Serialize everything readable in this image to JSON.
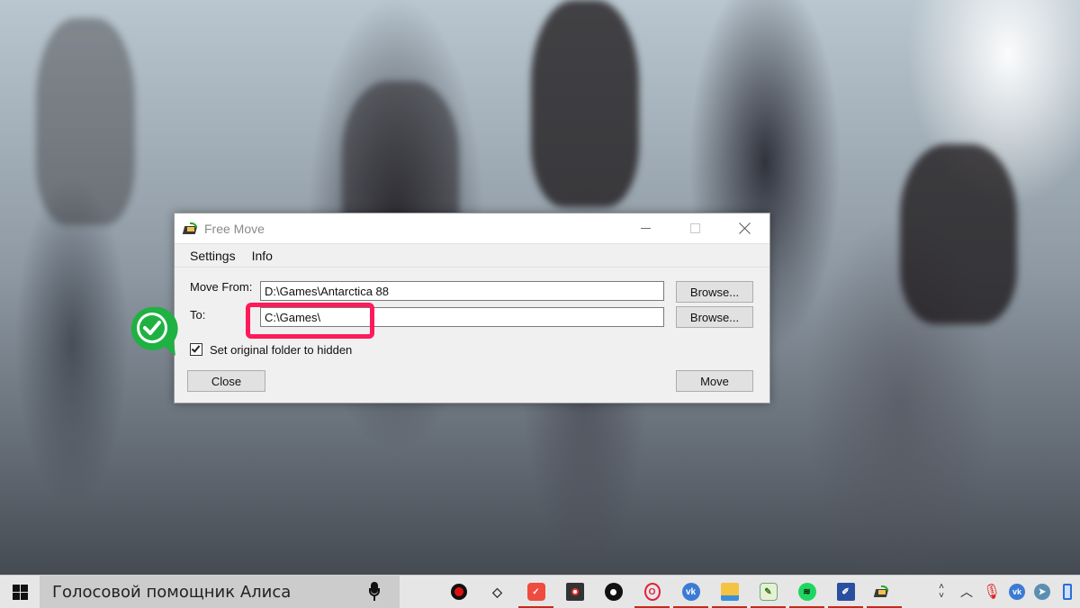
{
  "window": {
    "title": "Free Move",
    "controls": {
      "minimize": "minimize",
      "maximize": "maximize",
      "close": "close"
    },
    "menu": [
      {
        "label": "Settings"
      },
      {
        "label": "Info"
      }
    ],
    "form": {
      "move_from_label": "Move From:",
      "move_from_value": "D:\\Games\\Antarctica 88",
      "to_label": "To:",
      "to_value": "C:\\Games\\",
      "browse_label": "Browse...",
      "hidden_checkbox_label": "Set original folder to hidden",
      "hidden_checkbox_checked": true,
      "close_label": "Close",
      "move_label": "Move"
    }
  },
  "annotations": {
    "highlight_color": "#ff1a5a",
    "badge_color": "#1fb141"
  },
  "taskbar": {
    "search_text": "Голосовой помощник Алиса",
    "apps": [
      {
        "name": "recorder",
        "running": false
      },
      {
        "name": "stack",
        "running": false
      },
      {
        "name": "clock-app",
        "running": true
      },
      {
        "name": "media-record",
        "running": false
      },
      {
        "name": "music-disc",
        "running": false
      },
      {
        "name": "opera",
        "running": true
      },
      {
        "name": "vk",
        "running": true
      },
      {
        "name": "file-explorer",
        "running": true
      },
      {
        "name": "chart-editor",
        "running": true
      },
      {
        "name": "spotify",
        "running": true
      },
      {
        "name": "paint-tool",
        "running": true
      },
      {
        "name": "free-move",
        "running": true
      }
    ],
    "tray": [
      "scroll-updown",
      "show-hidden-icons",
      "microphone",
      "vk",
      "telegram",
      "battery"
    ]
  }
}
